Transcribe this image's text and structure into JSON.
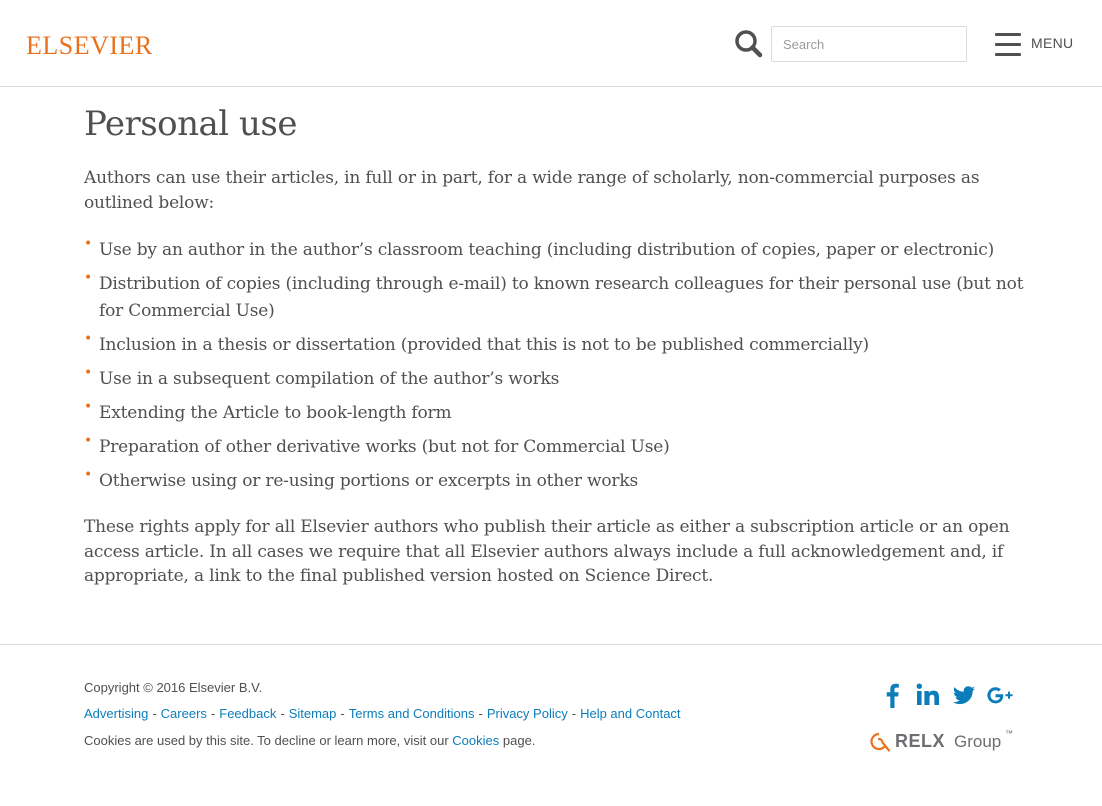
{
  "header": {
    "logo_text": "ELSEVIER",
    "search_placeholder": "Search",
    "search_value": "",
    "menu_label": "MENU",
    "accent_color": "#e9711c"
  },
  "main": {
    "title": "Personal use",
    "intro": "Authors can use their articles, in full or in part, for a wide range of scholarly, non-commercial purposes as outlined below:",
    "items": [
      "Use by an author in the author’s classroom teaching (including distribution of copies, paper or electronic)",
      "Distribution of copies (including through e-mail) to known research colleagues for their personal use (but not for Commercial Use)",
      "Inclusion in a thesis or dissertation (provided that this is not to be published commercially)",
      "Use in a subsequent compilation of the author’s works",
      "Extending the Article to book-length form",
      "Preparation of other derivative works (but not for Commercial Use)",
      "Otherwise using or re-using portions or excerpts in other works"
    ],
    "rights": "These rights apply for all Elsevier authors who publish their article as either a subscription article or an open access article. In all cases we require that all Elsevier authors always include a full acknowledgement and, if appropriate, a link to the final published version hosted on Science Direct."
  },
  "footer": {
    "copyright": "Copyright © 2016 Elsevier B.V.",
    "links": [
      "Advertising",
      "Careers",
      "Feedback",
      "Sitemap",
      "Terms and Conditions",
      "Privacy Policy",
      "Help and Contact"
    ],
    "separator": "-",
    "cookie_prefix": "Cookies are used by this site. To decline or learn more, visit our",
    "cookie_link": "Cookies",
    "cookie_suffix": "page.",
    "link_color": "#0c7dbb",
    "social_icons": [
      "facebook-icon",
      "linkedin-icon",
      "twitter-icon",
      "google-plus-icon"
    ],
    "relx_word": "RELX",
    "relx_group": "Group",
    "relx_tm": "™"
  }
}
